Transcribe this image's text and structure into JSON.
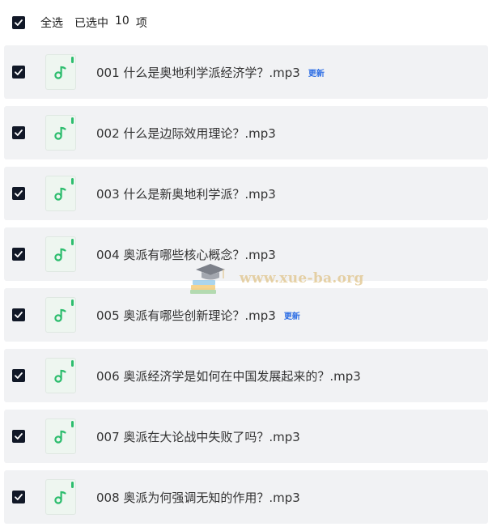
{
  "header": {
    "select_all_label": "全选",
    "selected_prefix": "已选中",
    "selected_count": "10",
    "selected_suffix": "项"
  },
  "items": [
    {
      "title": "001  什么是奥地利学派经济学？.mp3",
      "badge": "更新"
    },
    {
      "title": "002  什么是边际效用理论？.mp3",
      "badge": ""
    },
    {
      "title": "003  什么是新奥地利学派？.mp3",
      "badge": ""
    },
    {
      "title": "004  奥派有哪些核心概念？.mp3",
      "badge": ""
    },
    {
      "title": "005  奥派有哪些创新理论？.mp3",
      "badge": "更新"
    },
    {
      "title": "006  奥派经济学是如何在中国发展起来的？.mp3",
      "badge": ""
    },
    {
      "title": "007  奥派在大论战中失败了吗？.mp3",
      "badge": ""
    },
    {
      "title": "008  奥派为何强调无知的作用？.mp3",
      "badge": ""
    }
  ],
  "watermark": {
    "text": "www.xue-ba.org"
  },
  "colors": {
    "checkbox": "#111827",
    "row_bg": "#f1f2f4",
    "music_icon": "#2dbd6e",
    "badge": "#2f6fe4"
  },
  "icons": {
    "checkbox": "checkmark-icon",
    "file": "music-note-icon",
    "watermark": "graduation-cap-books-icon"
  }
}
